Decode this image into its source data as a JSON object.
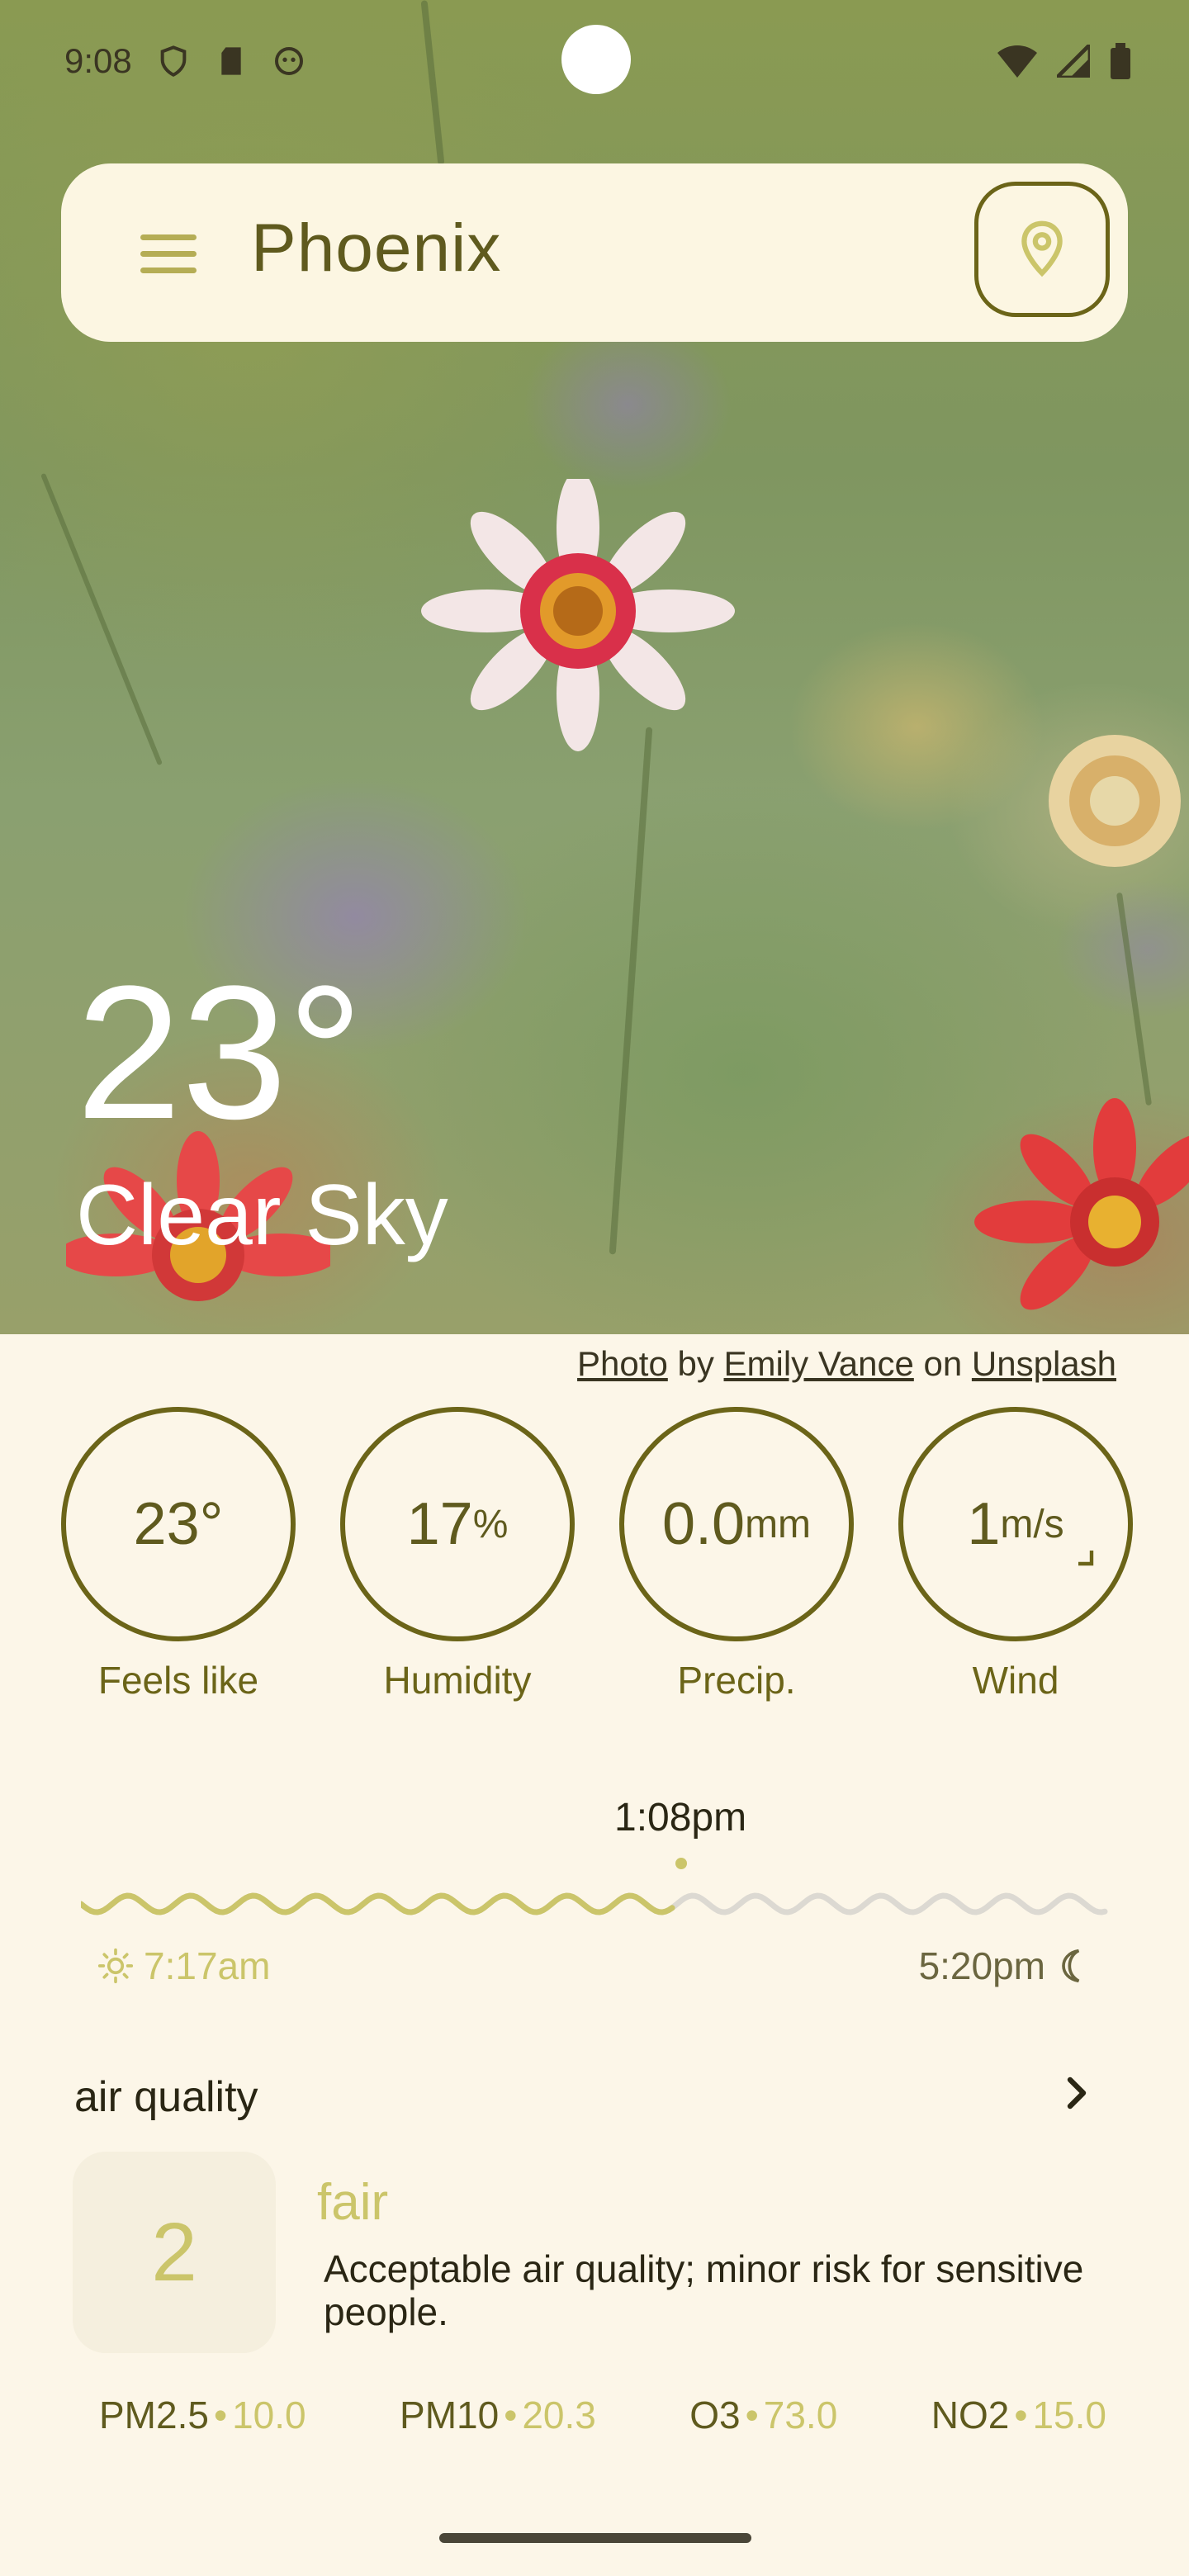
{
  "status_bar": {
    "time": "9:08"
  },
  "header": {
    "city": "Phoenix"
  },
  "current": {
    "temperature": "23°",
    "condition": "Clear Sky"
  },
  "photo_credit": {
    "photo": "Photo",
    "by": "by",
    "author": "Emily Vance",
    "on": "on",
    "site": "Unsplash"
  },
  "stats": [
    {
      "value": "23°",
      "unit": "",
      "label": "Feels like"
    },
    {
      "value": "17",
      "unit": "%",
      "label": "Humidity"
    },
    {
      "value": "0.0",
      "unit": "mm",
      "label": "Precip."
    },
    {
      "value": "1",
      "unit": "m/s",
      "label": "Wind"
    }
  ],
  "sun": {
    "now": "1:08pm",
    "sunrise": "7:17am",
    "sunset": "5:20pm",
    "day_progress": 0.58
  },
  "air_quality": {
    "title": "air quality",
    "index": "2",
    "level": "fair",
    "description": "Acceptable air quality; minor risk for sensitive people.",
    "pollutants": [
      {
        "name": "PM2.5",
        "value": "10.0"
      },
      {
        "name": "PM10",
        "value": "20.3"
      },
      {
        "name": "O3",
        "value": "73.0"
      },
      {
        "name": "NO2",
        "value": "15.0"
      }
    ]
  },
  "colors": {
    "accent": "#cbc56a",
    "dark_olive": "#6b6418",
    "background": "#fcf6e8"
  }
}
